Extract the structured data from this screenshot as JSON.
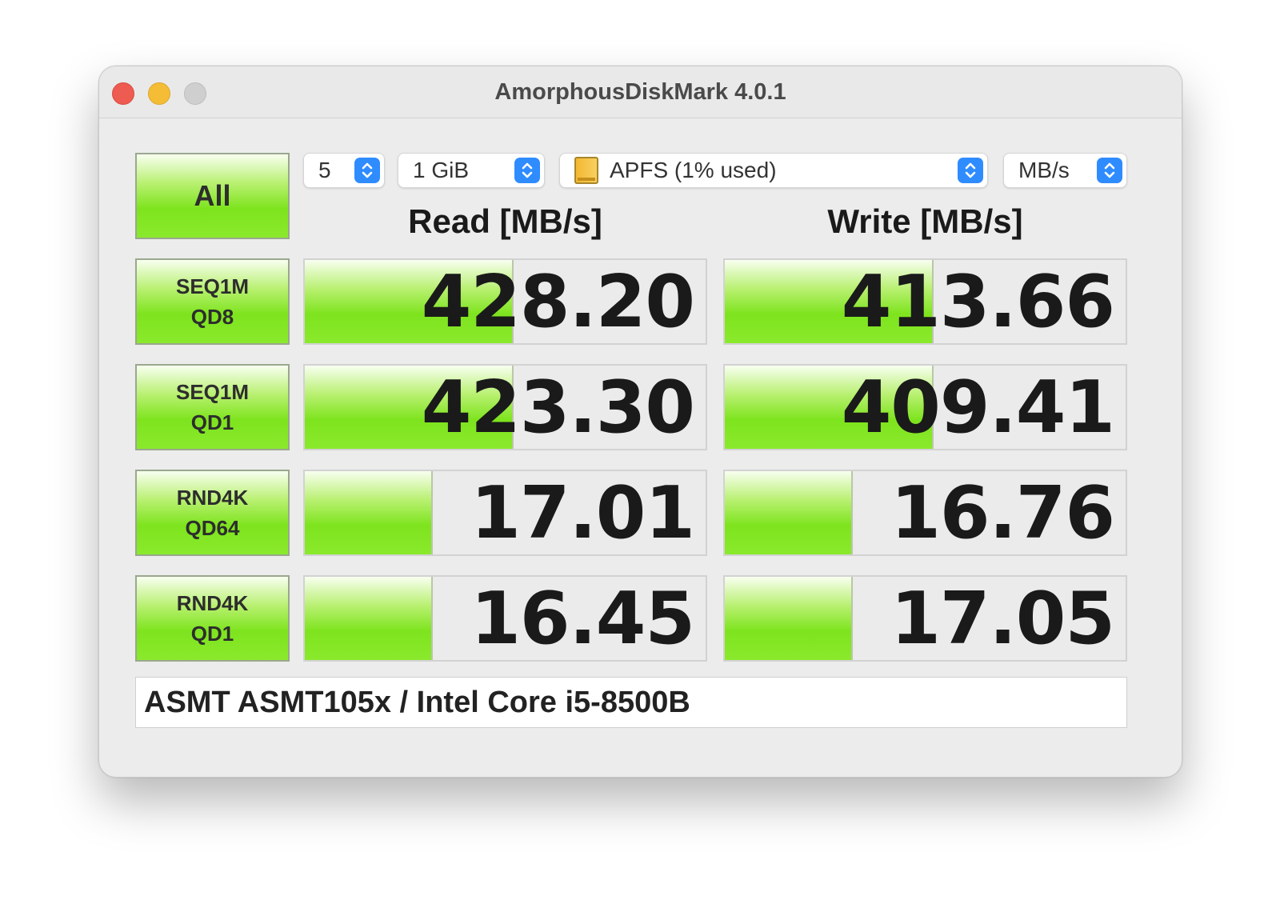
{
  "window": {
    "title": "AmorphousDiskMark 4.0.1"
  },
  "controls": {
    "all_label": "All",
    "count": "5",
    "size": "1 GiB",
    "drive": "APFS (1% used)",
    "unit": "MB/s"
  },
  "headers": {
    "read": "Read [MB/s]",
    "write": "Write [MB/s]"
  },
  "tests": [
    {
      "line1": "SEQ1M",
      "line2": "QD8",
      "read": "428.20",
      "write": "413.66",
      "read_fill": 0.52,
      "write_fill": 0.52
    },
    {
      "line1": "SEQ1M",
      "line2": "QD1",
      "read": "423.30",
      "write": "409.41",
      "read_fill": 0.52,
      "write_fill": 0.52
    },
    {
      "line1": "RND4K",
      "line2": "QD64",
      "read": "17.01",
      "write": "16.76",
      "read_fill": 0.32,
      "write_fill": 0.32
    },
    {
      "line1": "RND4K",
      "line2": "QD1",
      "read": "16.45",
      "write": "17.05",
      "read_fill": 0.32,
      "write_fill": 0.32
    }
  ],
  "footer": {
    "device": "ASMT ASMT105x / Intel Core i5-8500B"
  },
  "colors": {
    "accent": "#2f8cff",
    "bar_green": "#7ee41e",
    "close": "#ee5b50",
    "minimize": "#f5bd36",
    "maximize": "#cfcfcf"
  }
}
